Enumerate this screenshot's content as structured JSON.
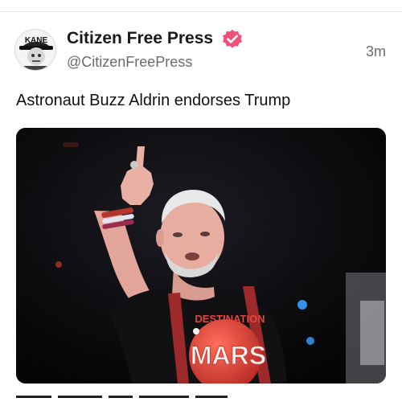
{
  "post": {
    "author": {
      "display_name": "Citizen Free Press",
      "handle": "@CitizenFreePress",
      "avatar_text": "KANE",
      "verified": true
    },
    "timestamp": "3m",
    "text": "Astronaut Buzz Aldrin endorses Trump",
    "media": {
      "shirt_top_text": "DESTINATION",
      "shirt_main_text": "MARS"
    }
  },
  "colors": {
    "verified_badge": "#f0517a",
    "shirt_text": "#e3463a",
    "suspenders": "#9d2a2a",
    "background": "#070708"
  },
  "icons": {
    "verified": "verified-badge-icon"
  }
}
